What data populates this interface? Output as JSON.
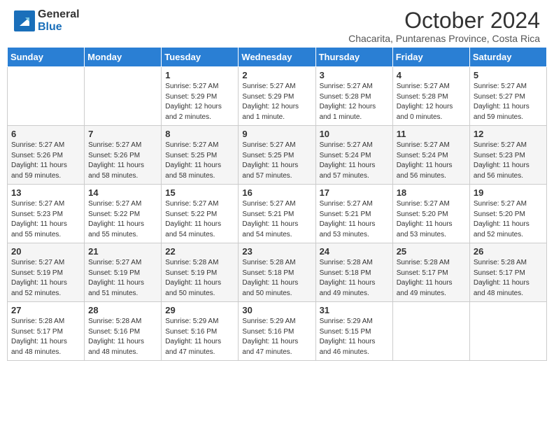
{
  "header": {
    "logo_general": "General",
    "logo_blue": "Blue",
    "month_title": "October 2024",
    "subtitle": "Chacarita, Puntarenas Province, Costa Rica"
  },
  "days_of_week": [
    "Sunday",
    "Monday",
    "Tuesday",
    "Wednesday",
    "Thursday",
    "Friday",
    "Saturday"
  ],
  "weeks": [
    [
      {
        "day": "",
        "info": ""
      },
      {
        "day": "",
        "info": ""
      },
      {
        "day": "1",
        "info": "Sunrise: 5:27 AM\nSunset: 5:29 PM\nDaylight: 12 hours and 2 minutes."
      },
      {
        "day": "2",
        "info": "Sunrise: 5:27 AM\nSunset: 5:29 PM\nDaylight: 12 hours and 1 minute."
      },
      {
        "day": "3",
        "info": "Sunrise: 5:27 AM\nSunset: 5:28 PM\nDaylight: 12 hours and 1 minute."
      },
      {
        "day": "4",
        "info": "Sunrise: 5:27 AM\nSunset: 5:28 PM\nDaylight: 12 hours and 0 minutes."
      },
      {
        "day": "5",
        "info": "Sunrise: 5:27 AM\nSunset: 5:27 PM\nDaylight: 11 hours and 59 minutes."
      }
    ],
    [
      {
        "day": "6",
        "info": "Sunrise: 5:27 AM\nSunset: 5:26 PM\nDaylight: 11 hours and 59 minutes."
      },
      {
        "day": "7",
        "info": "Sunrise: 5:27 AM\nSunset: 5:26 PM\nDaylight: 11 hours and 58 minutes."
      },
      {
        "day": "8",
        "info": "Sunrise: 5:27 AM\nSunset: 5:25 PM\nDaylight: 11 hours and 58 minutes."
      },
      {
        "day": "9",
        "info": "Sunrise: 5:27 AM\nSunset: 5:25 PM\nDaylight: 11 hours and 57 minutes."
      },
      {
        "day": "10",
        "info": "Sunrise: 5:27 AM\nSunset: 5:24 PM\nDaylight: 11 hours and 57 minutes."
      },
      {
        "day": "11",
        "info": "Sunrise: 5:27 AM\nSunset: 5:24 PM\nDaylight: 11 hours and 56 minutes."
      },
      {
        "day": "12",
        "info": "Sunrise: 5:27 AM\nSunset: 5:23 PM\nDaylight: 11 hours and 56 minutes."
      }
    ],
    [
      {
        "day": "13",
        "info": "Sunrise: 5:27 AM\nSunset: 5:23 PM\nDaylight: 11 hours and 55 minutes."
      },
      {
        "day": "14",
        "info": "Sunrise: 5:27 AM\nSunset: 5:22 PM\nDaylight: 11 hours and 55 minutes."
      },
      {
        "day": "15",
        "info": "Sunrise: 5:27 AM\nSunset: 5:22 PM\nDaylight: 11 hours and 54 minutes."
      },
      {
        "day": "16",
        "info": "Sunrise: 5:27 AM\nSunset: 5:21 PM\nDaylight: 11 hours and 54 minutes."
      },
      {
        "day": "17",
        "info": "Sunrise: 5:27 AM\nSunset: 5:21 PM\nDaylight: 11 hours and 53 minutes."
      },
      {
        "day": "18",
        "info": "Sunrise: 5:27 AM\nSunset: 5:20 PM\nDaylight: 11 hours and 53 minutes."
      },
      {
        "day": "19",
        "info": "Sunrise: 5:27 AM\nSunset: 5:20 PM\nDaylight: 11 hours and 52 minutes."
      }
    ],
    [
      {
        "day": "20",
        "info": "Sunrise: 5:27 AM\nSunset: 5:19 PM\nDaylight: 11 hours and 52 minutes."
      },
      {
        "day": "21",
        "info": "Sunrise: 5:27 AM\nSunset: 5:19 PM\nDaylight: 11 hours and 51 minutes."
      },
      {
        "day": "22",
        "info": "Sunrise: 5:28 AM\nSunset: 5:19 PM\nDaylight: 11 hours and 50 minutes."
      },
      {
        "day": "23",
        "info": "Sunrise: 5:28 AM\nSunset: 5:18 PM\nDaylight: 11 hours and 50 minutes."
      },
      {
        "day": "24",
        "info": "Sunrise: 5:28 AM\nSunset: 5:18 PM\nDaylight: 11 hours and 49 minutes."
      },
      {
        "day": "25",
        "info": "Sunrise: 5:28 AM\nSunset: 5:17 PM\nDaylight: 11 hours and 49 minutes."
      },
      {
        "day": "26",
        "info": "Sunrise: 5:28 AM\nSunset: 5:17 PM\nDaylight: 11 hours and 48 minutes."
      }
    ],
    [
      {
        "day": "27",
        "info": "Sunrise: 5:28 AM\nSunset: 5:17 PM\nDaylight: 11 hours and 48 minutes."
      },
      {
        "day": "28",
        "info": "Sunrise: 5:28 AM\nSunset: 5:16 PM\nDaylight: 11 hours and 48 minutes."
      },
      {
        "day": "29",
        "info": "Sunrise: 5:29 AM\nSunset: 5:16 PM\nDaylight: 11 hours and 47 minutes."
      },
      {
        "day": "30",
        "info": "Sunrise: 5:29 AM\nSunset: 5:16 PM\nDaylight: 11 hours and 47 minutes."
      },
      {
        "day": "31",
        "info": "Sunrise: 5:29 AM\nSunset: 5:15 PM\nDaylight: 11 hours and 46 minutes."
      },
      {
        "day": "",
        "info": ""
      },
      {
        "day": "",
        "info": ""
      }
    ]
  ]
}
